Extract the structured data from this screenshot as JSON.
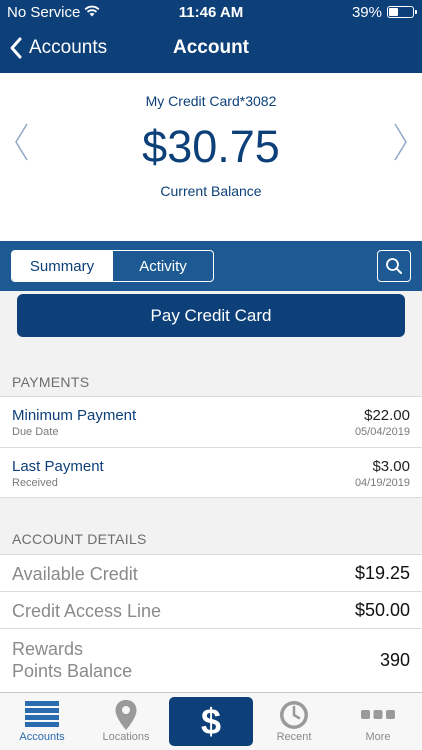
{
  "status_bar": {
    "carrier": "No Service",
    "time": "11:46 AM",
    "battery": "39%",
    "battery_level": 0.39
  },
  "nav": {
    "back_label": "Accounts",
    "title": "Account"
  },
  "account": {
    "name": "My Credit Card*3082",
    "balance": "$30.75",
    "balance_label": "Current Balance"
  },
  "tabs": {
    "summary": "Summary",
    "activity": "Activity",
    "selected": "Summary"
  },
  "pay_button": "Pay Credit Card",
  "payments": {
    "heading": "PAYMENTS",
    "rows": [
      {
        "label": "Minimum Payment",
        "sub": "Due Date",
        "amount": "$22.00",
        "date": "05/04/2019"
      },
      {
        "label": "Last Payment",
        "sub": "Received",
        "amount": "$3.00",
        "date": "04/19/2019"
      }
    ]
  },
  "details": {
    "heading": "ACCOUNT DETAILS",
    "rows": [
      {
        "label": "Available Credit",
        "value": "$19.25"
      },
      {
        "label": "Credit Access Line",
        "value": "$50.00"
      },
      {
        "label_line1": "Rewards",
        "label_line2": "Points Balance",
        "value": "390"
      }
    ]
  },
  "bottom_tabs": [
    {
      "label": "Accounts",
      "icon": "list-icon",
      "selected": true
    },
    {
      "label": "Locations",
      "icon": "location-pin-icon"
    },
    {
      "label": "",
      "icon": "dollar-icon",
      "glyph": "$"
    },
    {
      "label": "Recent",
      "icon": "clock-icon"
    },
    {
      "label": "More",
      "icon": "more-dots-icon"
    }
  ],
  "colors": {
    "primary": "#0d4079",
    "tab_bar": "#1d5a94",
    "selected_tab": "#2b6cb0",
    "background": "#f2f2f2"
  }
}
